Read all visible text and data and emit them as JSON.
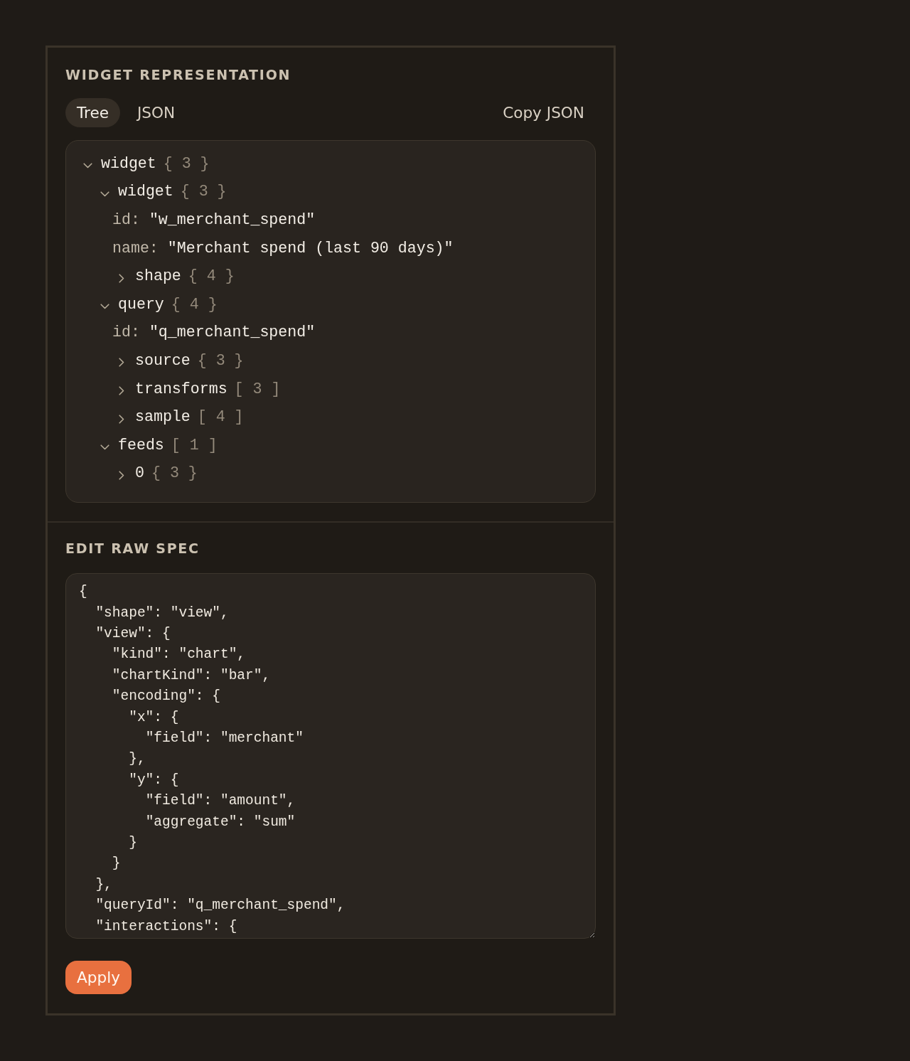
{
  "representation": {
    "title": "WIDGET REPRESENTATION",
    "tabs": [
      {
        "label": "Tree",
        "selected": true
      },
      {
        "label": "JSON",
        "selected": false
      }
    ],
    "copy_button": "Copy JSON",
    "tree": [
      {
        "kind": "branch",
        "key": "widget",
        "count": "{ 3 }",
        "expanded": true,
        "children": [
          {
            "kind": "branch",
            "key": "widget",
            "count": "{ 3 }",
            "expanded": true,
            "children": [
              {
                "kind": "leaf",
                "key": "id:",
                "value": "\"w_merchant_spend\""
              },
              {
                "kind": "leaf",
                "key": "name:",
                "value": "\"Merchant spend (last 90 days)\""
              },
              {
                "kind": "branch",
                "key": "shape",
                "count": "{ 4 }",
                "expanded": false
              }
            ]
          },
          {
            "kind": "branch",
            "key": "query",
            "count": "{ 4 }",
            "expanded": true,
            "children": [
              {
                "kind": "leaf",
                "key": "id:",
                "value": "\"q_merchant_spend\""
              },
              {
                "kind": "branch",
                "key": "source",
                "count": "{ 3 }",
                "expanded": false
              },
              {
                "kind": "branch",
                "key": "transforms",
                "count": "[ 3 ]",
                "expanded": false
              },
              {
                "kind": "branch",
                "key": "sample",
                "count": "[ 4 ]",
                "expanded": false
              }
            ]
          },
          {
            "kind": "branch",
            "key": "feeds",
            "count": "[ 1 ]",
            "expanded": true,
            "children": [
              {
                "kind": "branch",
                "key": "0",
                "count": "{ 3 }",
                "expanded": false
              }
            ]
          }
        ]
      }
    ]
  },
  "editor": {
    "title": "EDIT RAW SPEC",
    "value": "{\n  \"shape\": \"view\",\n  \"view\": {\n    \"kind\": \"chart\",\n    \"chartKind\": \"bar\",\n    \"encoding\": {\n      \"x\": {\n        \"field\": \"merchant\"\n      },\n      \"y\": {\n        \"field\": \"amount\",\n        \"aggregate\": \"sum\"\n      }\n    }\n  },\n  \"queryId\": \"q_merchant_spend\",\n  \"interactions\": {",
    "apply_button": "Apply"
  }
}
